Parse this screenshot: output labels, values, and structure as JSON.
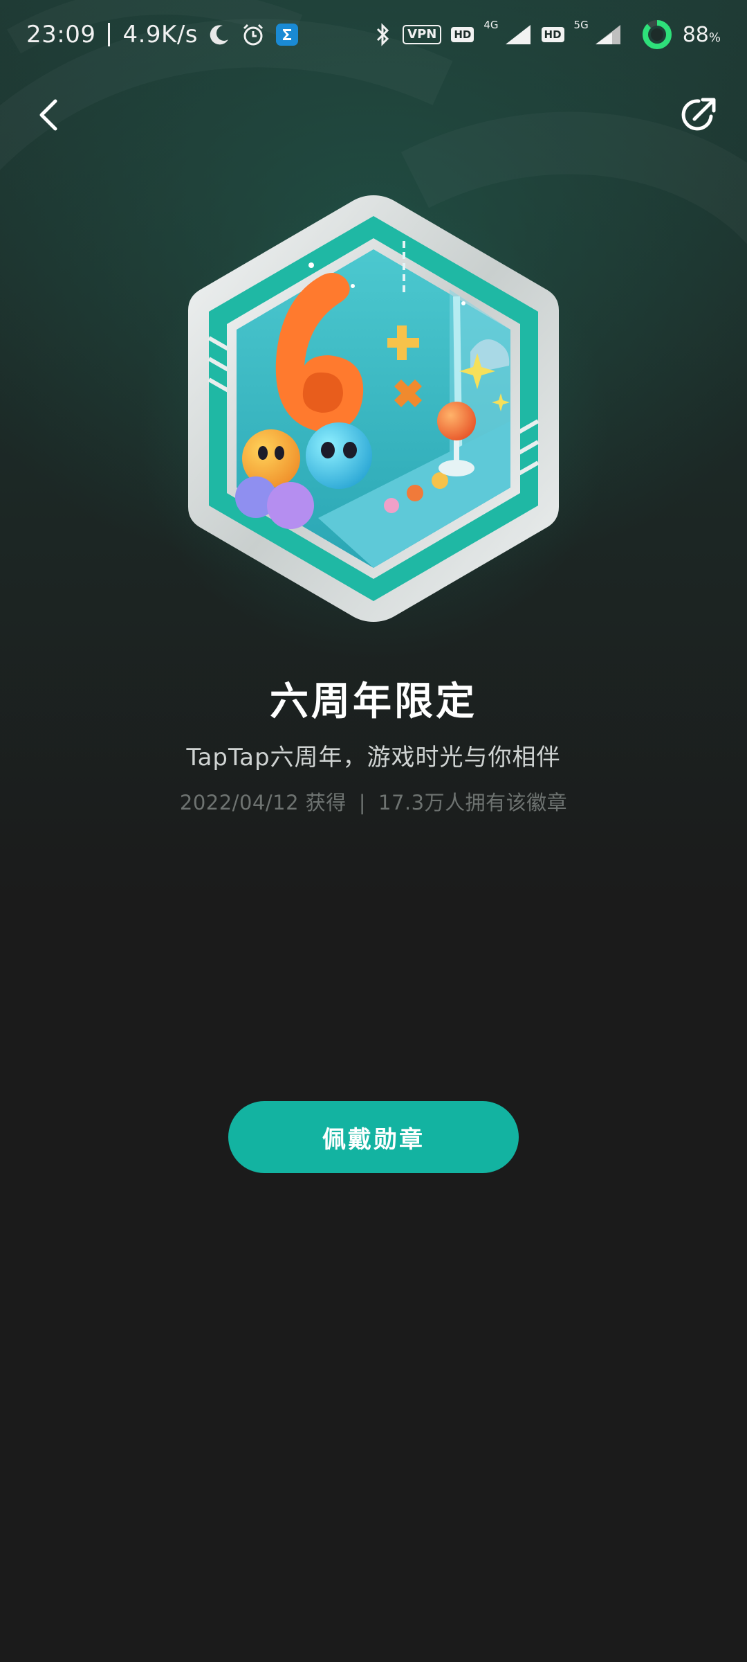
{
  "status_bar": {
    "time": "23:09",
    "net_speed": "4.9K/s",
    "vpn_label": "VPN",
    "hd_label_1": "HD",
    "net_type_1": "4G",
    "hd_label_2": "HD",
    "net_type_2": "5G",
    "battery_value": "88",
    "battery_unit": "%",
    "battery_level_percent": 88,
    "icons": [
      "moon-icon",
      "alarm-icon",
      "sigma-app-icon",
      "bluetooth-icon",
      "vpn-icon",
      "hd-icon",
      "signal-icon",
      "battery-ring-icon"
    ]
  },
  "nav": {
    "back_icon": "chevron-left-icon",
    "share_icon": "share-icon"
  },
  "badge": {
    "title": "六周年限定",
    "description": "TapTap六周年，游戏时光与你相伴",
    "obtained_date": "2022/04/12 获得",
    "separator": "|",
    "owners": "17.3万人拥有该徽章",
    "art_number": "6"
  },
  "actions": {
    "wear_label": "佩戴勋章"
  },
  "colors": {
    "accent": "#13b3a1",
    "background": "#1b1b1b",
    "badge_teal": "#1fb8a4"
  }
}
